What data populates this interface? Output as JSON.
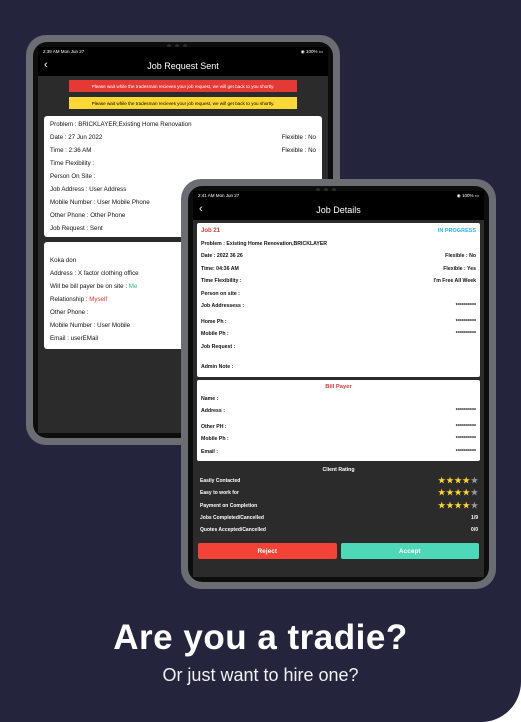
{
  "tablet_back": {
    "status": {
      "time": "2:39 AM  Mon Jun 27",
      "battery": "100%"
    },
    "nav": {
      "back": "‹",
      "title": "Job Request Sent"
    },
    "banners": [
      "Please wait while the tradesman recieves your job request, we will get back to you shortly.",
      "Please wait while the tradesman recieves your job request, we will get back to you shortly."
    ],
    "details": {
      "problem": "Problem : BRICKLAYER,Existing Home Renovation",
      "date": "Date : 27 Jun 2022",
      "date_flex": "Flexible : No",
      "time": "Time : 2:36 AM",
      "time_flex": "Flexible : No",
      "time_flexibility": "Time Flexibility :",
      "person_on_site": "Person On Site :",
      "job_address": "Job Address : User Address",
      "mobile_number": "Mobile Number : User Mobile Phone",
      "other_phone": "Other Phone : Other Phone",
      "job_request": "Job Request : Sent"
    },
    "bill": {
      "header": "Bill P",
      "name": "Koka don",
      "address": "Address : X factor clothing office",
      "bill_payer_label": "Will be bill payer be on site : ",
      "bill_payer_value": "Me",
      "relationship_label": "Relationship : ",
      "relationship_value": "Myself",
      "other_phone": "Other Phone :",
      "mobile_number": "Mobile Number : User Mobile",
      "email": "Email : userEMail"
    }
  },
  "tablet_front": {
    "status": {
      "time": "2:41 AM  Mon Jun 27",
      "battery": "100%"
    },
    "nav": {
      "back": "‹",
      "title": "Job Details"
    },
    "job": {
      "number": "Job 21",
      "state": "IN PROGRESS",
      "problem": "Problem : Existing Home Renovation,BRICKLAYER",
      "date": "Date : 2022 36 26",
      "date_flex": "Flexible : No",
      "time": "Time: 04:36 AM",
      "time_flex": "Flexible : Yes",
      "time_flexibility": "Time Flexibility :",
      "time_flexibility_value": "I'm Free All Week",
      "person_on_site": "Person on site :",
      "job_address": "Job Addressess :",
      "job_address_value": "**********",
      "home_ph": "Home Ph :",
      "home_ph_value": "**********",
      "mobile_ph": "Mobile Ph :",
      "mobile_ph_value": "**********",
      "job_request": "Job Request  :",
      "admin_note": "Admin Note  :"
    },
    "bill": {
      "title": "Bill Payer",
      "name": "Name :",
      "address": "Address :",
      "address_value": "**********",
      "other_ph": "Other PH :",
      "other_ph_value": "**********",
      "mobile_ph": "Mobile Ph :",
      "mobile_ph_value": "**********",
      "email": "Email :",
      "email_value": "**********"
    },
    "rating": {
      "title": "Client Rating",
      "items": [
        {
          "label": "Easily Contacted",
          "stars": 4,
          "max": 5
        },
        {
          "label": "Easy to work for",
          "stars": 4,
          "max": 5
        },
        {
          "label": "Payment on Completion",
          "stars": 4,
          "max": 5
        }
      ],
      "jobs_completed_label": "Jobs Completed/Cancelled",
      "jobs_completed_value": "1/9",
      "quotes_label": "Quotes Accepted/Cancelled",
      "quotes_value": "0/0"
    },
    "buttons": {
      "reject": "Reject",
      "accept": "Accept"
    }
  },
  "headline": "Are you a tradie?",
  "subheadline": "Or just want to hire one?",
  "colors": {
    "background": "#24253d",
    "reject": "#f44336",
    "accept": "#4dd8b8",
    "accent_red": "#e53935",
    "in_progress": "#29b6f6",
    "star": "#fdd835"
  }
}
